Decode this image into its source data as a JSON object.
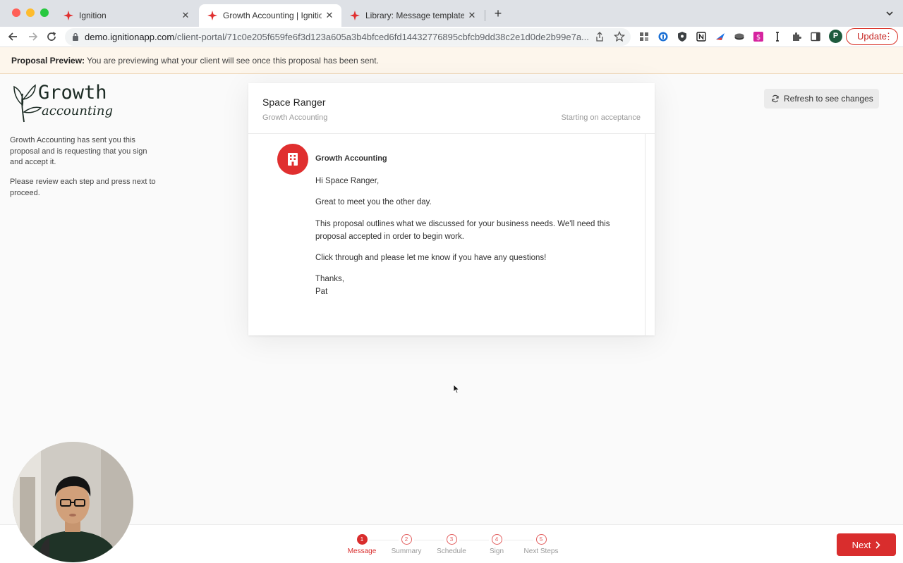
{
  "browser": {
    "tabs": [
      {
        "title": "Ignition",
        "active": false
      },
      {
        "title": "Growth Accounting | Ignition P",
        "active": true
      },
      {
        "title": "Library: Message templates | Ig",
        "active": false
      }
    ],
    "url_host": "demo.ignitionapp.com",
    "url_path": "/client-portal/71c0e205f659fe6f3d123a605a3b4bfced6fd14432776895cbfcb9dd38c2e1d0de2b99e7a...",
    "profile_initial": "P",
    "update_label": "Update",
    "accent_color": "#d92d2d"
  },
  "banner": {
    "label": "Proposal Preview:",
    "text": "You are previewing what your client will see once this proposal has been sent."
  },
  "sidebar": {
    "logo_line1": "Growth",
    "logo_line2": "accounting",
    "intro": "Growth Accounting has sent you this proposal and is requesting that you sign and accept it.",
    "instructions": "Please review each step and press next to proceed."
  },
  "refresh": {
    "label": "Refresh to see changes"
  },
  "card": {
    "client_name": "Space Ranger",
    "firm_name": "Growth Accounting",
    "start_text": "Starting on acceptance",
    "sender": "Growth Accounting",
    "message": {
      "greeting": "Hi Space Ranger,",
      "p1": "Great to meet you the other day.",
      "p2": "This proposal outlines what we discussed for your business needs. We'll need this proposal accepted in order to begin work.",
      "p3": "Click through and please let me know if you have any questions!",
      "signoff": "Thanks,",
      "signature": "Pat"
    }
  },
  "steps": [
    {
      "num": "1",
      "label": "Message",
      "active": true
    },
    {
      "num": "2",
      "label": "Summary",
      "active": false
    },
    {
      "num": "3",
      "label": "Schedule",
      "active": false
    },
    {
      "num": "4",
      "label": "Sign",
      "active": false
    },
    {
      "num": "5",
      "label": "Next Steps",
      "active": false
    }
  ],
  "next_button": {
    "label": "Next"
  }
}
